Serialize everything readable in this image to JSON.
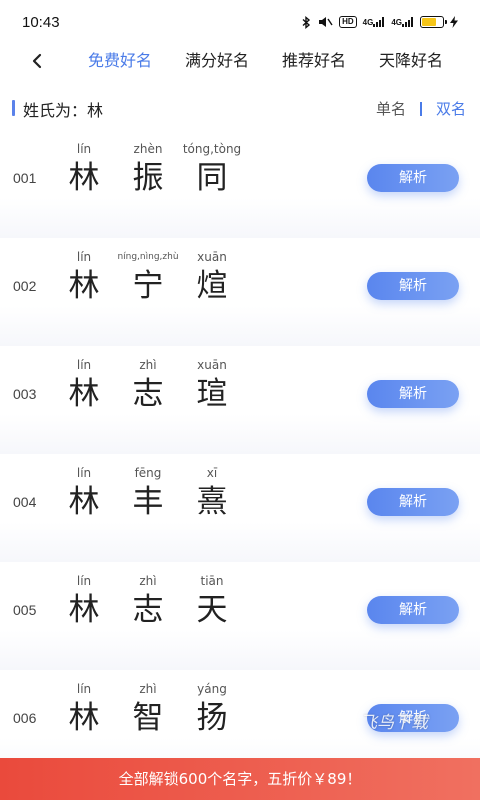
{
  "status_bar": {
    "time": "10:43",
    "hd_badge": "HD",
    "net1": "4G",
    "net2": "4G",
    "battery_level": 0.7,
    "battery_color": "#f5c518"
  },
  "header": {
    "back_icon": "chevron-left-icon",
    "tabs": [
      {
        "label": "免费好名"
      },
      {
        "label": "满分好名"
      },
      {
        "label": "推荐好名"
      },
      {
        "label": "天降好名"
      }
    ],
    "active_tab": 0,
    "accent_color": "#4a7be8"
  },
  "surname": {
    "text": "姓氏为：林",
    "mode_single": "单名",
    "mode_double": "双名",
    "active_mode": "双名"
  },
  "names": [
    {
      "index": "001",
      "chars": [
        {
          "pinyin": "lín",
          "hanzi": "林"
        },
        {
          "pinyin": "zhèn",
          "hanzi": "振"
        },
        {
          "pinyin": "tóng,tòng",
          "hanzi": "同"
        }
      ],
      "button": "解析"
    },
    {
      "index": "002",
      "chars": [
        {
          "pinyin": "lín",
          "hanzi": "林"
        },
        {
          "pinyin": "níng,nìng,zhù",
          "hanzi": "宁"
        },
        {
          "pinyin": "xuān",
          "hanzi": "煊"
        }
      ],
      "button": "解析"
    },
    {
      "index": "003",
      "chars": [
        {
          "pinyin": "lín",
          "hanzi": "林"
        },
        {
          "pinyin": "zhì",
          "hanzi": "志"
        },
        {
          "pinyin": "xuān",
          "hanzi": "瑄"
        }
      ],
      "button": "解析"
    },
    {
      "index": "004",
      "chars": [
        {
          "pinyin": "lín",
          "hanzi": "林"
        },
        {
          "pinyin": "fēng",
          "hanzi": "丰"
        },
        {
          "pinyin": "xī",
          "hanzi": "熹"
        }
      ],
      "button": "解析"
    },
    {
      "index": "005",
      "chars": [
        {
          "pinyin": "lín",
          "hanzi": "林"
        },
        {
          "pinyin": "zhì",
          "hanzi": "志"
        },
        {
          "pinyin": "tiān",
          "hanzi": "天"
        }
      ],
      "button": "解析"
    },
    {
      "index": "006",
      "chars": [
        {
          "pinyin": "lín",
          "hanzi": "林"
        },
        {
          "pinyin": "zhì",
          "hanzi": "智"
        },
        {
          "pinyin": "yáng",
          "hanzi": "扬"
        }
      ],
      "button": "解析"
    }
  ],
  "watermark": "飞鸟下载",
  "banner": {
    "text": "全部解锁600个名字，五折价￥89！",
    "color": "#ea4a3c"
  }
}
